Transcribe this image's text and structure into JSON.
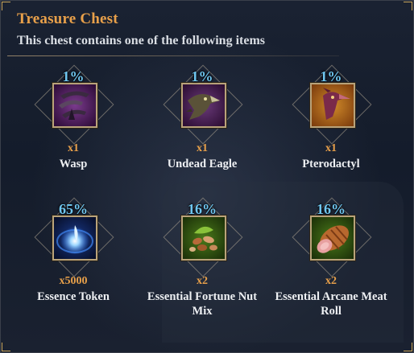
{
  "title": "Treasure Chest",
  "subtitle": "This chest contains one of the following items",
  "colors": {
    "accent": "#e8a04a",
    "percent": "#6fc6f0",
    "frame": "#b9a37a"
  },
  "items": [
    {
      "percent": "1%",
      "qty": "x1",
      "name": "Wasp",
      "icon": "wasp-icon"
    },
    {
      "percent": "1%",
      "qty": "x1",
      "name": "Undead Eagle",
      "icon": "undead-eagle-icon"
    },
    {
      "percent": "1%",
      "qty": "x1",
      "name": "Pterodactyl",
      "icon": "pterodactyl-icon"
    },
    {
      "percent": "65%",
      "qty": "x5000",
      "name": "Essence Token",
      "icon": "essence-token-icon"
    },
    {
      "percent": "16%",
      "qty": "x2",
      "name": "Essential Fortune Nut Mix",
      "icon": "nut-mix-icon"
    },
    {
      "percent": "16%",
      "qty": "x2",
      "name": "Essential Arcane Meat Roll",
      "icon": "meat-roll-icon"
    }
  ]
}
